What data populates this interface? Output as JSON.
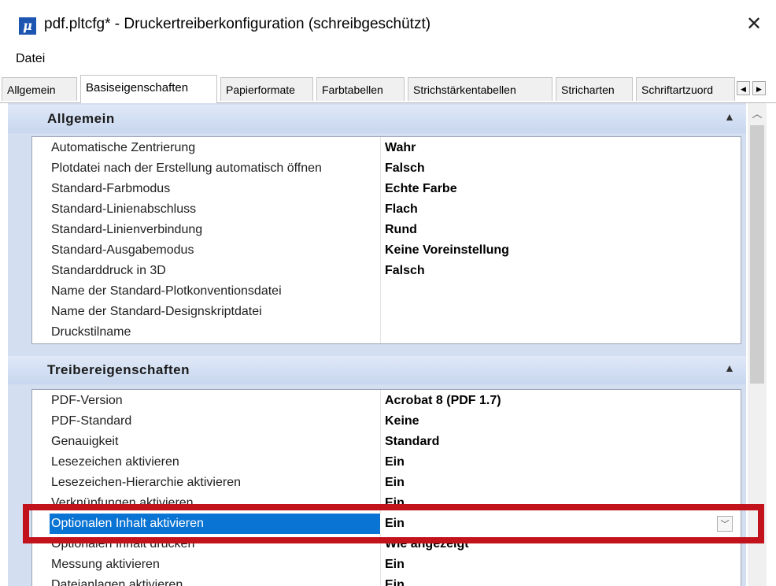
{
  "window": {
    "title": "pdf.pltcfg* - Druckertreiberkonfiguration (schreibgeschützt)",
    "close_icon": "close-icon",
    "app_icon_glyph": "μ"
  },
  "menu": {
    "items": [
      {
        "label": "Datei"
      }
    ]
  },
  "tabs": {
    "items": [
      {
        "label": "Allgemein"
      },
      {
        "label": "Basiseigenschaften"
      },
      {
        "label": "Papierformate"
      },
      {
        "label": "Farbtabellen"
      },
      {
        "label": "Strichstärkentabellen"
      },
      {
        "label": "Stricharten"
      },
      {
        "label": "Schriftartzuord"
      }
    ],
    "active": "Basiseigenschaften"
  },
  "sections": [
    {
      "title": "Allgemein",
      "rows": [
        {
          "name": "Automatische Zentrierung",
          "value": "Wahr"
        },
        {
          "name": "Plotdatei nach der Erstellung automatisch öffnen",
          "value": "Falsch"
        },
        {
          "name": "Standard-Farbmodus",
          "value": "Echte Farbe"
        },
        {
          "name": "Standard-Linienabschluss",
          "value": "Flach"
        },
        {
          "name": "Standard-Linienverbindung",
          "value": "Rund"
        },
        {
          "name": "Standard-Ausgabemodus",
          "value": "Keine Voreinstellung"
        },
        {
          "name": "Standarddruck in 3D",
          "value": "Falsch"
        },
        {
          "name": "Name der Standard-Plotkonventionsdatei",
          "value": ""
        },
        {
          "name": "Name der Standard-Designskriptdatei",
          "value": ""
        },
        {
          "name": "Druckstilname",
          "value": ""
        }
      ]
    },
    {
      "title": "Treibereigenschaften",
      "rows": [
        {
          "name": "PDF-Version",
          "value": "Acrobat 8 (PDF 1.7)"
        },
        {
          "name": "PDF-Standard",
          "value": "Keine"
        },
        {
          "name": "Genauigkeit",
          "value": "Standard"
        },
        {
          "name": "Lesezeichen aktivieren",
          "value": "Ein"
        },
        {
          "name": "Lesezeichen-Hierarchie aktivieren",
          "value": "Ein"
        },
        {
          "name": "Verknüpfungen aktivieren",
          "value": "Ein"
        },
        {
          "name": "Optionalen Inhalt aktivieren",
          "value": "Ein"
        },
        {
          "name": "Optionalen Inhalt drucken",
          "value": "Wie angezeigt"
        },
        {
          "name": "Messung aktivieren",
          "value": "Ein"
        },
        {
          "name": "Dateianlagen aktivieren",
          "value": "Ein"
        }
      ]
    }
  ],
  "colors": {
    "selection": "#0a74d4",
    "highlight_border": "#c2121c",
    "section_bg": "#d3def0"
  }
}
